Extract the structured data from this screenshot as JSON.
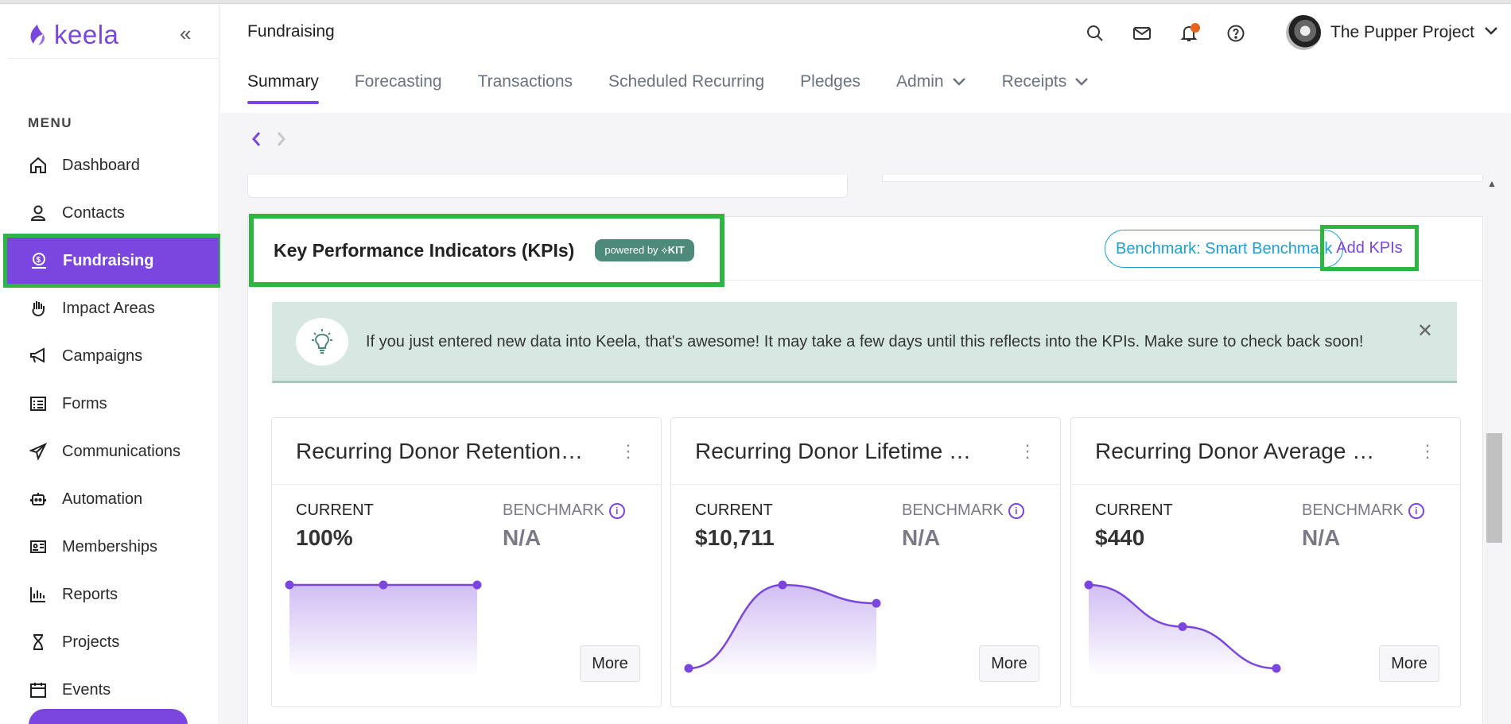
{
  "app": {
    "logo_text": "keela",
    "colors": {
      "accent": "#7b46df",
      "highlight": "#2db642",
      "benchmark": "#1aa0d8",
      "badge": "#4e8a79",
      "notification": "#e8641b"
    }
  },
  "sidebar": {
    "menu_label": "MENU",
    "items": [
      {
        "label": "Dashboard",
        "icon": "home-icon"
      },
      {
        "label": "Contacts",
        "icon": "person-icon"
      },
      {
        "label": "Fundraising",
        "icon": "dollar-icon",
        "active": true
      },
      {
        "label": "Impact Areas",
        "icon": "hand-icon"
      },
      {
        "label": "Campaigns",
        "icon": "megaphone-icon"
      },
      {
        "label": "Forms",
        "icon": "form-icon"
      },
      {
        "label": "Communications",
        "icon": "send-icon"
      },
      {
        "label": "Automation",
        "icon": "robot-icon"
      },
      {
        "label": "Memberships",
        "icon": "id-card-icon"
      },
      {
        "label": "Reports",
        "icon": "bar-chart-icon"
      },
      {
        "label": "Projects",
        "icon": "hourglass-icon"
      },
      {
        "label": "Events",
        "icon": "calendar-icon"
      }
    ]
  },
  "header": {
    "title": "Fundraising",
    "org_name": "The Pupper Project",
    "tabs": [
      {
        "label": "Summary",
        "active": true
      },
      {
        "label": "Forecasting"
      },
      {
        "label": "Transactions"
      },
      {
        "label": "Scheduled Recurring"
      },
      {
        "label": "Pledges"
      },
      {
        "label": "Admin",
        "dropdown": true
      },
      {
        "label": "Receipts",
        "dropdown": true
      }
    ]
  },
  "kpi": {
    "title": "Key Performance Indicators (KPIs)",
    "badge_prefix": "powered by",
    "badge_brand": "KIT",
    "benchmark_button": "Benchmark: Smart Benchmark",
    "add_button": "Add KPIs",
    "banner_text": "If you just entered new data into Keela, that's awesome! It may take a few days until this reflects into the KPIs. Make sure to check back soon!",
    "current_label": "CURRENT",
    "benchmark_label": "BENCHMARK",
    "more_label": "More",
    "cards": [
      {
        "title": "Recurring Donor Retention…",
        "current": "100%",
        "benchmark": "N/A",
        "trend": [
          1,
          1,
          1
        ]
      },
      {
        "title": "Recurring Donor Lifetime …",
        "current": "$10,711",
        "benchmark": "N/A",
        "trend": [
          0.0,
          1.0,
          0.78
        ]
      },
      {
        "title": "Recurring Donor Average …",
        "current": "$440",
        "benchmark": "N/A",
        "trend": [
          1.0,
          0.5,
          0.0
        ]
      }
    ]
  }
}
